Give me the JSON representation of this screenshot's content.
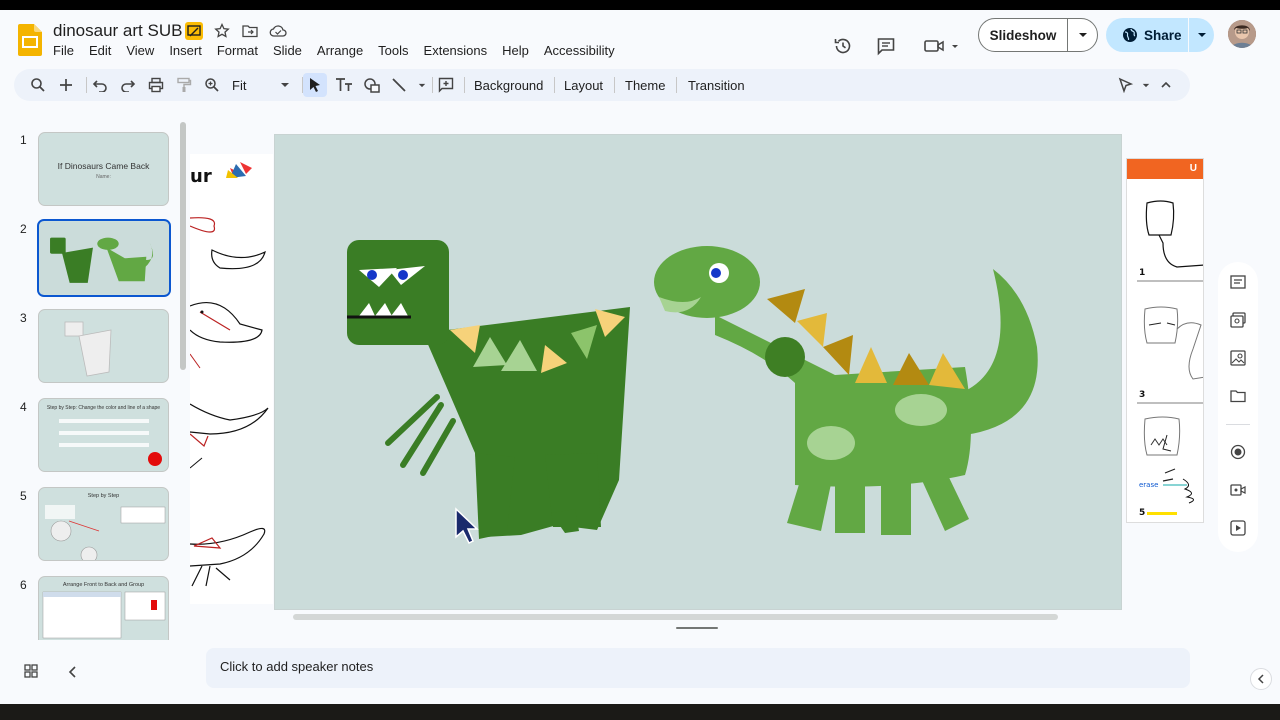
{
  "doc": {
    "title": "dinosaur art SUB"
  },
  "menu": [
    "File",
    "Edit",
    "View",
    "Insert",
    "Format",
    "Slide",
    "Arrange",
    "Tools",
    "Extensions",
    "Help",
    "Accessibility"
  ],
  "header": {
    "slideshow_label": "Slideshow",
    "share_label": "Share"
  },
  "toolbar": {
    "zoom_value": "Fit",
    "background_label": "Background",
    "layout_label": "Layout",
    "theme_label": "Theme",
    "transition_label": "Transition"
  },
  "slides": [
    {
      "number": "1",
      "title": "If Dinosaurs Came Back",
      "subtitle": "Name:"
    },
    {
      "number": "2"
    },
    {
      "number": "3"
    },
    {
      "number": "4",
      "title": "Step by Step: Change the color and line of a shape"
    },
    {
      "number": "5",
      "title": "Step by Step"
    },
    {
      "number": "6",
      "title": "Arrange Front to Back and Group"
    }
  ],
  "side_right": {
    "header": "U",
    "steps": [
      "1",
      "3",
      "5"
    ],
    "erase_label": "erase"
  },
  "notes": {
    "placeholder": "Click to add speaker notes"
  },
  "colors": {
    "slide_bg": "#cbdcda",
    "accent": "#0b57d0",
    "trex": "#3a7d25",
    "bronto": "#62a844"
  }
}
